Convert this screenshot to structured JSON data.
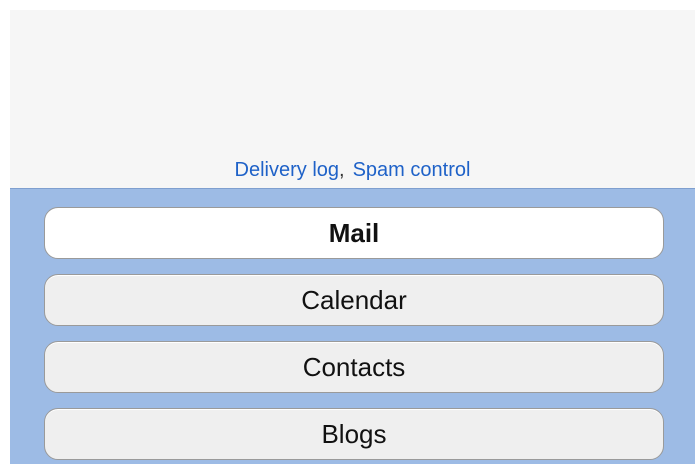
{
  "links": {
    "delivery_log": "Delivery log",
    "separator": ",",
    "spam_control": "Spam control"
  },
  "nav": {
    "items": [
      {
        "label": "Mail",
        "active": true
      },
      {
        "label": "Calendar",
        "active": false
      },
      {
        "label": "Contacts",
        "active": false
      },
      {
        "label": "Blogs",
        "active": false
      }
    ]
  },
  "colors": {
    "link": "#1f62c8",
    "nav_background": "#9dbbe5",
    "top_background": "#f6f6f6"
  }
}
